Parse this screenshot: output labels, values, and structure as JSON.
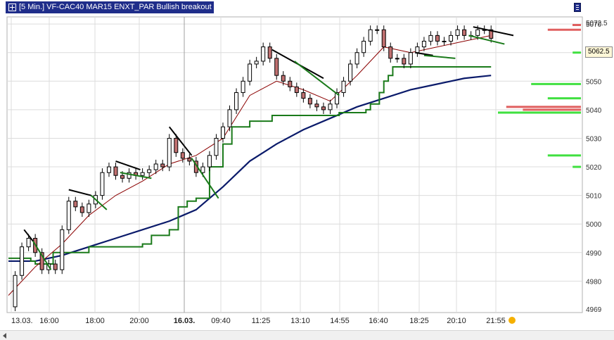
{
  "window": {
    "title": "[5 Min.] VF-CAC40 MAR15    ENXT_PAR Bullish breakout",
    "current_price_label": "5062.5",
    "top_price_label": "5072.5",
    "bottom_price_label": "4969"
  },
  "icons": {
    "title_toggle": "plus-box-icon",
    "settings": "list-settings-icon",
    "scroll_left": "triangle-left-icon",
    "status_dot": "orange-dot-icon"
  },
  "colors": {
    "title_bg": "#1f2d8a",
    "candle_up": "#ffffff",
    "candle_down": "#c07070",
    "sma_fast": "#8b0000",
    "sma_slow": "#0a1a6a",
    "support_line": "#1a7a1a",
    "trend_marker_dark": "#000000",
    "trend_marker_green": "#1a7a1a",
    "volume_profile_red": "#e06060",
    "volume_profile_green": "#40e040",
    "status_dot": "#f5b000"
  },
  "chart_data": {
    "type": "line",
    "title": "[5 Min.] VF-CAC40 MAR15    ENXT_PAR Bullish breakout",
    "xlabel": "",
    "ylabel": "",
    "x_ticks": [
      "13.03.",
      "16:00",
      "18:00",
      "20:00",
      "16.03.",
      "09:40",
      "11:25",
      "13:10",
      "14:55",
      "16:40",
      "18:25",
      "20:10",
      "21:55"
    ],
    "y_ticks": [
      4980,
      4990,
      5000,
      5010,
      5020,
      5030,
      5040,
      5050,
      5060,
      5070
    ],
    "ylim": [
      4969,
      5072.5
    ],
    "grid": true,
    "legend": "none",
    "series": [
      {
        "kind": "close",
        "x": [
          0,
          3,
          6,
          9,
          12,
          15,
          18,
          21,
          24,
          27,
          30,
          33,
          36,
          39,
          42,
          45,
          48,
          51,
          54,
          57,
          60,
          63,
          66,
          69,
          72,
          75,
          78,
          81,
          84,
          87,
          90,
          93,
          96,
          99,
          102,
          105,
          108,
          111,
          114,
          117,
          120,
          123,
          126,
          129,
          132,
          135,
          138,
          141,
          144,
          147,
          150,
          153,
          156,
          159,
          162,
          165,
          168,
          171,
          174,
          177,
          180,
          183,
          186,
          189,
          192,
          195,
          198,
          201,
          204,
          207,
          210,
          213,
          216
        ],
        "values": [
          4971,
          4982,
          4992,
          4995,
          4990,
          4984,
          4986,
          4984,
          4998,
          5008,
          5006,
          5004,
          5007,
          5010,
          5018,
          5020,
          5017,
          5016,
          5018,
          5017,
          5018,
          5019,
          5021,
          5020,
          5030,
          5025,
          5023,
          5022,
          5018,
          5020,
          5024,
          5030,
          5034,
          5040,
          5046,
          5050,
          5056,
          5057,
          5062,
          5058,
          5052,
          5050,
          5048,
          5046,
          5044,
          5042,
          5041,
          5040,
          5042,
          5046,
          5050,
          5056,
          5060,
          5064,
          5068,
          5068,
          5062,
          5058,
          5058,
          5056,
          5060,
          5062,
          5064,
          5066,
          5064,
          5064,
          5066,
          5068,
          5066,
          5066,
          5068,
          5068,
          5065
        ]
      },
      {
        "kind": "sma_fast",
        "x": [
          0,
          12,
          24,
          36,
          48,
          60,
          72,
          84,
          96,
          108,
          120,
          132,
          144,
          156,
          168,
          180,
          192,
          204,
          216
        ],
        "values": [
          4975,
          4985,
          4993,
          5003,
          5010,
          5015,
          5021,
          5024,
          5030,
          5045,
          5050,
          5047,
          5043,
          5052,
          5062,
          5060,
          5062,
          5064,
          5066
        ]
      },
      {
        "kind": "sma_slow",
        "x": [
          0,
          12,
          24,
          36,
          48,
          60,
          72,
          84,
          96,
          108,
          120,
          132,
          144,
          156,
          168,
          180,
          192,
          204,
          216
        ],
        "values": [
          4987,
          4987,
          4989,
          4992,
          4995,
          4998,
          5001,
          5005,
          5013,
          5022,
          5028,
          5033,
          5037,
          5041,
          5044,
          5047,
          5049,
          5051,
          5052
        ]
      },
      {
        "kind": "support_step",
        "x": [
          0,
          8,
          10,
          12,
          20,
          36,
          48,
          60,
          64,
          72,
          76,
          80,
          82,
          84,
          90,
          96,
          100,
          108,
          118,
          120,
          140,
          148,
          160,
          162,
          166,
          168,
          170,
          172,
          176,
          180,
          216
        ],
        "values": [
          4988,
          4988,
          4987,
          4986,
          4990,
          4992,
          4992,
          4993,
          4996,
          4998,
          5006,
          5008,
          5008,
          5009,
          5020,
          5028,
          5034,
          5036,
          5038,
          5038,
          5038,
          5039,
          5040,
          5042,
          5046,
          5050,
          5052,
          5055,
          5055,
          5055,
          5055
        ]
      }
    ],
    "trend_markers": [
      {
        "color": "dark",
        "x0": 7,
        "y0": 4998,
        "x1": 11,
        "y1": 4994
      },
      {
        "color": "green",
        "x0": 11,
        "y0": 4994,
        "x1": 19,
        "y1": 4984
      },
      {
        "color": "dark",
        "x0": 27,
        "y0": 5012,
        "x1": 37,
        "y1": 5010
      },
      {
        "color": "green",
        "x0": 37,
        "y0": 5010,
        "x1": 44,
        "y1": 5005
      },
      {
        "color": "dark",
        "x0": 48,
        "y0": 5022,
        "x1": 59,
        "y1": 5019
      },
      {
        "color": "green",
        "x0": 50,
        "y0": 5018,
        "x1": 64,
        "y1": 5016
      },
      {
        "color": "dark",
        "x0": 72,
        "y0": 5034,
        "x1": 82,
        "y1": 5024
      },
      {
        "color": "green",
        "x0": 82,
        "y0": 5023,
        "x1": 94,
        "y1": 5009
      },
      {
        "color": "dark",
        "x0": 118,
        "y0": 5061,
        "x1": 141,
        "y1": 5051
      },
      {
        "color": "green",
        "x0": 128,
        "y0": 5057,
        "x1": 148,
        "y1": 5045
      },
      {
        "color": "dark",
        "x0": 182,
        "y0": 5060,
        "x1": 190,
        "y1": 5059
      },
      {
        "color": "green",
        "x0": 186,
        "y0": 5059,
        "x1": 200,
        "y1": 5058
      },
      {
        "color": "dark",
        "x0": 208,
        "y0": 5069,
        "x1": 226,
        "y1": 5066
      },
      {
        "color": "green",
        "x0": 206,
        "y0": 5066,
        "x1": 222,
        "y1": 5063
      }
    ],
    "volume_profile": [
      {
        "price": 5068,
        "size": 0.4,
        "color": "red"
      },
      {
        "price": 5060,
        "size": 0.1,
        "color": "green"
      },
      {
        "price": 5049,
        "size": 0.6,
        "color": "green"
      },
      {
        "price": 5044,
        "size": 0.4,
        "color": "green"
      },
      {
        "price": 5041,
        "size": 0.9,
        "color": "red"
      },
      {
        "price": 5040,
        "size": 0.7,
        "color": "red"
      },
      {
        "price": 5039,
        "size": 1.0,
        "color": "green"
      },
      {
        "price": 5024,
        "size": 0.4,
        "color": "green"
      },
      {
        "price": 5020,
        "size": 0.1,
        "color": "green"
      }
    ]
  }
}
